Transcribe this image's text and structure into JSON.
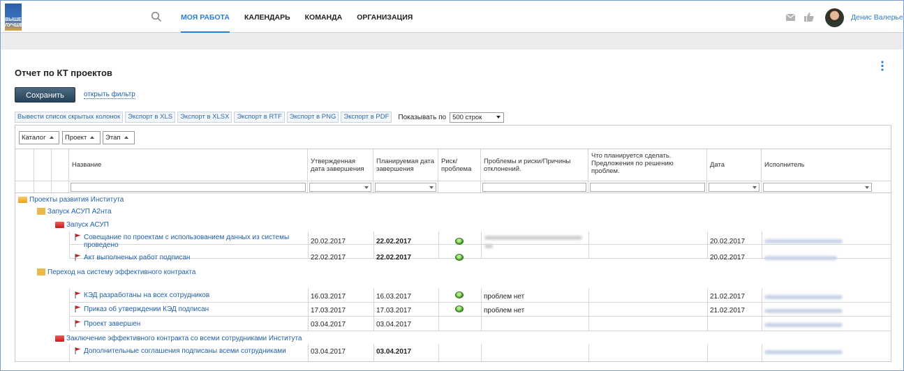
{
  "header": {
    "logo_text": "ВЫШЕ ЛУЧШЕ",
    "nav": [
      {
        "label": "МОЯ РАБОТА",
        "active": true
      },
      {
        "label": "КАЛЕНДАРЬ",
        "active": false
      },
      {
        "label": "КОМАНДА",
        "active": false
      },
      {
        "label": "ОРГАНИЗАЦИЯ",
        "active": false
      }
    ],
    "user_name": "Денис Валерьевич",
    "accent_color": "#2d7fd3"
  },
  "page": {
    "title": "Отчет по КТ проектов",
    "save_label": "Сохранить",
    "filter_link": "открыть фильтр"
  },
  "toolbar": {
    "buttons": [
      "Вывести список скрытых колонок",
      "Экспорт в XLS",
      "Экспорт в XLSX",
      "Экспорт в RTF",
      "Экспорт в PNG",
      "Экспорт в PDF"
    ],
    "show_label": "Показывать по",
    "show_value": "500 строк"
  },
  "grid": {
    "group_chips": [
      "Каталог",
      "Проект",
      "Этап"
    ],
    "columns": [
      "Название",
      "Утвержденная дата завершения",
      "Планируемая дата завершения",
      "Риск/ проблема",
      "Проблемы и риски/Причины отклонений.",
      "Что планируется сделать. Предложения по решению проблем.",
      "Дата",
      "Исполнитель"
    ],
    "catalog": "Проекты развития Института",
    "projects": [
      {
        "name": "Запуск АСУП А2нта",
        "stage": "Запуск АСУП",
        "rows": [
          {
            "name": "Совещание по проектам с использованием данных из системы проведено",
            "approved": "20.02.2017",
            "planned": "22.02.2017",
            "planned_bold": true,
            "risk": "green",
            "date": "20.02.2017"
          },
          {
            "name": "Акт выполненых работ подписан",
            "approved": "22.02.2017",
            "planned": "22.02.2017",
            "planned_bold": true,
            "risk": "green",
            "date": "20.02.2017"
          }
        ]
      },
      {
        "name": "Переход на систему эффективного контракта",
        "rows": [
          {
            "name": "КЭД разработаны на всех сотрудников",
            "approved": "16.03.2017",
            "planned": "16.03.2017",
            "risk": "green",
            "problems": "проблем нет",
            "date": "21.02.2017"
          },
          {
            "name": "Приказ об утверждении КЭД подписан",
            "approved": "17.03.2017",
            "planned": "17.03.2017",
            "risk": "green",
            "problems": "проблем нет",
            "date": "21.02.2017"
          },
          {
            "name": "Проект завершен",
            "approved": "03.04.2017",
            "planned": "03.04.2017"
          }
        ],
        "stage2": "Заключение эффективного контракта со всеми сотрудниками Института",
        "rows2": [
          {
            "name": "Дополнительные соглашения подписаны всеми сотрудниками",
            "approved": "03.04.2017",
            "planned": "03.04.2017",
            "planned_bold": true
          }
        ]
      }
    ]
  }
}
